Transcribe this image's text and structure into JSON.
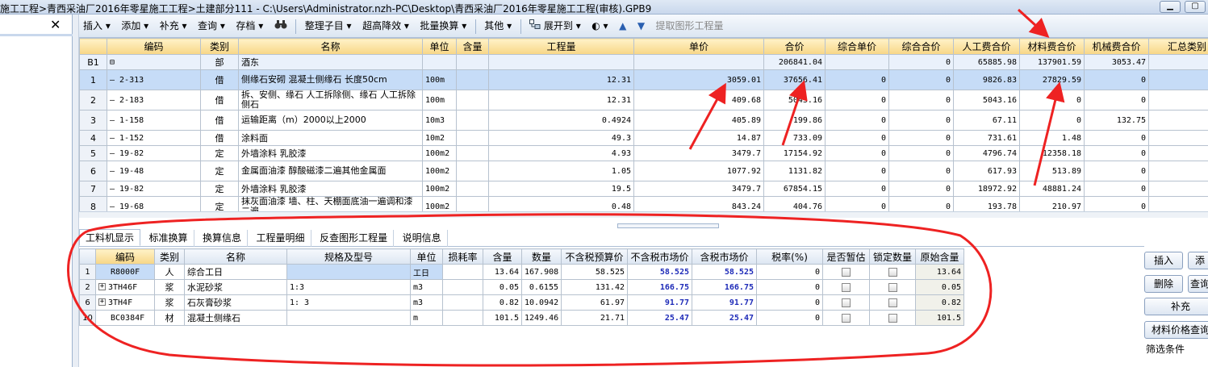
{
  "window": {
    "title": "施工工程>青西采油厂2016年零星施工工程>土建部分111 - C:\\Users\\Administrator.nzh-PC\\Desktop\\青西采油厂2016年零星施工工程(审核).GPB9",
    "minimize": "▁",
    "maximize": "▢"
  },
  "left_panel": {
    "close": "✕"
  },
  "toolbar": {
    "insert": "插入 ▾",
    "add": "添加 ▾",
    "supplement": "补充 ▾",
    "query": "查询 ▾",
    "save": "存档 ▾",
    "find_icon": "binoculars-icon",
    "organize": "整理子目 ▾",
    "raise": "超高降效 ▾",
    "batch": "批量换算 ▾",
    "other": "其他 ▾",
    "expand": "展开到 ▾",
    "paint": "◐ ▾",
    "up": "▲",
    "down": "▼",
    "extract": "提取图形工程量"
  },
  "upper_table": {
    "headers": [
      "",
      "编码",
      "类别",
      "名称",
      "单位",
      "含量",
      "工程量",
      "单价",
      "合价",
      "综合单价",
      "综合合价",
      "人工费合价",
      "材料费合价",
      "机械费合价",
      "汇总类别"
    ],
    "rows": [
      {
        "rn": "B1",
        "code": "⊟",
        "type": "部",
        "name": "酒东",
        "unit": "",
        "content": "",
        "qty": "",
        "price": "",
        "total": "206841.04",
        "comp_price": "",
        "comp_total": "0",
        "labor": "65885.98",
        "material": "137901.59",
        "machine": "3053.47",
        "sum_type": ""
      },
      {
        "rn": "1",
        "code": "2-313",
        "type": "借",
        "name": "侧缘石安砌 混凝土侧缘石 长度50cm",
        "unit": "100m",
        "content": "",
        "qty": "12.31",
        "price": "3059.01",
        "total": "37656.41",
        "comp_price": "0",
        "comp_total": "0",
        "labor": "9826.83",
        "material": "27829.59",
        "machine": "0",
        "sum_type": ""
      },
      {
        "rn": "2",
        "code": "2-183",
        "type": "借",
        "name": "拆、安侧、缘石 人工拆除侧、缘石 人工拆除 侧石",
        "unit": "100m",
        "content": "",
        "qty": "12.31",
        "price": "409.68",
        "total": "5043.16",
        "comp_price": "0",
        "comp_total": "0",
        "labor": "5043.16",
        "material": "0",
        "machine": "0",
        "sum_type": ""
      },
      {
        "rn": "3",
        "code": "1-158",
        "type": "借",
        "name": "运输距离（m）2000以上2000",
        "unit": "10m3",
        "content": "",
        "qty": "0.4924",
        "price": "405.89",
        "total": "199.86",
        "comp_price": "0",
        "comp_total": "0",
        "labor": "67.11",
        "material": "0",
        "machine": "132.75",
        "sum_type": ""
      },
      {
        "rn": "4",
        "code": "1-152",
        "type": "借",
        "name": "涂料面",
        "unit": "10m2",
        "content": "",
        "qty": "49.3",
        "price": "14.87",
        "total": "733.09",
        "comp_price": "0",
        "comp_total": "0",
        "labor": "731.61",
        "material": "1.48",
        "machine": "0",
        "sum_type": ""
      },
      {
        "rn": "5",
        "code": "19-82",
        "type": "定",
        "name": "外墙涂料 乳胶漆",
        "unit": "100m2",
        "content": "",
        "qty": "4.93",
        "price": "3479.7",
        "total": "17154.92",
        "comp_price": "0",
        "comp_total": "0",
        "labor": "4796.74",
        "material": "12358.18",
        "machine": "0",
        "sum_type": ""
      },
      {
        "rn": "6",
        "code": "19-48",
        "type": "定",
        "name": "金属面油漆 醇酸磁漆二遍其他金属面",
        "unit": "100m2",
        "content": "",
        "qty": "1.05",
        "price": "1077.92",
        "total": "1131.82",
        "comp_price": "0",
        "comp_total": "0",
        "labor": "617.93",
        "material": "513.89",
        "machine": "0",
        "sum_type": ""
      },
      {
        "rn": "7",
        "code": "19-82",
        "type": "定",
        "name": "外墙涂料 乳胶漆",
        "unit": "100m2",
        "content": "",
        "qty": "19.5",
        "price": "3479.7",
        "total": "67854.15",
        "comp_price": "0",
        "comp_total": "0",
        "labor": "18972.92",
        "material": "48881.24",
        "machine": "0",
        "sum_type": ""
      },
      {
        "rn": "8",
        "code": "19-68",
        "type": "定",
        "name": "抹灰面油漆 墙、柱、天棚面底油一遍调和漆二遍",
        "unit": "100m2",
        "content": "",
        "qty": "0.48",
        "price": "843.24",
        "total": "404.76",
        "comp_price": "0",
        "comp_total": "0",
        "labor": "193.78",
        "material": "210.97",
        "machine": "0",
        "sum_type": ""
      }
    ]
  },
  "tabs": [
    "工料机显示",
    "标准换算",
    "换算信息",
    "工程量明细",
    "反查图形工程量",
    "说明信息"
  ],
  "lower_table": {
    "headers": [
      "",
      "编码",
      "类别",
      "名称",
      "规格及型号",
      "单位",
      "损耗率",
      "含量",
      "数量",
      "不含税预算价",
      "不含税市场价",
      "含税市场价",
      "税率(%)",
      "是否暂估",
      "锁定数量",
      "原始含量"
    ],
    "rows": [
      {
        "rn": "1",
        "exp": "",
        "code": "R8000F",
        "type": "人",
        "name": "综合工日",
        "spec": "",
        "unit": "工日",
        "loss": "",
        "content": "13.64",
        "qty": "167.908",
        "budget": "58.525",
        "market": "58.525",
        "market_tax": "58.525",
        "tax": "0",
        "orig": "13.64"
      },
      {
        "rn": "2",
        "exp": "+",
        "code": "3TH46F",
        "type": "浆",
        "name": "水泥砂浆",
        "spec": "1:3",
        "unit": "m3",
        "loss": "",
        "content": "0.05",
        "qty": "0.6155",
        "budget": "131.42",
        "market": "166.75",
        "market_tax": "166.75",
        "tax": "0",
        "orig": "0.05"
      },
      {
        "rn": "6",
        "exp": "+",
        "code": "3TH4F",
        "type": "浆",
        "name": "石灰膏砂浆",
        "spec": "1: 3",
        "unit": "m3",
        "loss": "",
        "content": "0.82",
        "qty": "10.0942",
        "budget": "61.97",
        "market": "91.77",
        "market_tax": "91.77",
        "tax": "0",
        "orig": "0.82"
      },
      {
        "rn": "10",
        "exp": "",
        "code": "BC0384F",
        "type": "材",
        "name": "混凝土侧缘石",
        "spec": "",
        "unit": "m",
        "loss": "",
        "content": "101.5",
        "qty": "1249.46",
        "budget": "21.71",
        "market": "25.47",
        "market_tax": "25.47",
        "tax": "0",
        "orig": "101.5"
      }
    ]
  },
  "right_panel": {
    "insert": "插入",
    "add": "添",
    "delete": "删除",
    "query": "查询",
    "supplement": "补充",
    "price_query": "材料价格查询",
    "filter": "筛选条件"
  },
  "colors": {
    "annotation_red": "#ee2222",
    "header_yellow": "#f7d686",
    "selected_row": "#c6dcf7",
    "bold_blue": "#1e2bb8"
  }
}
